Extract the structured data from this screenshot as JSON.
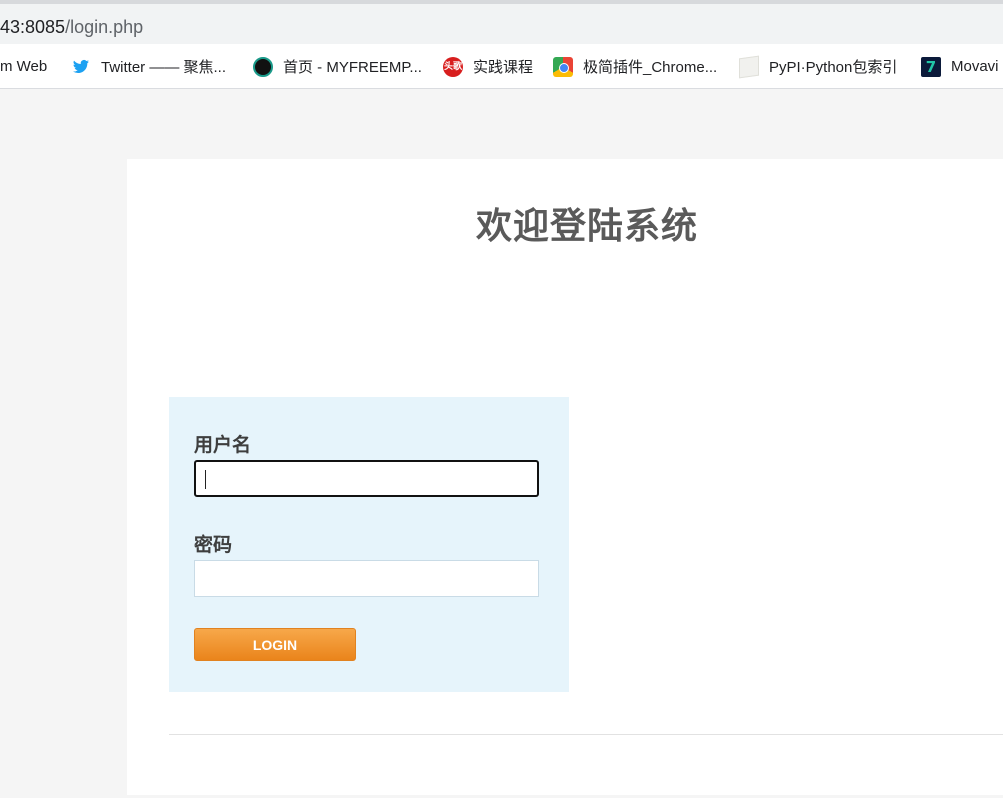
{
  "browser": {
    "url_host": "43:8085",
    "url_path": "/login.php"
  },
  "bookmarks": [
    {
      "label": "m Web",
      "icon": "none"
    },
    {
      "label": "Twitter —— 聚焦...",
      "icon": "twitter-icon"
    },
    {
      "label": "首页 - MYFREEMP...",
      "icon": "myfreemp-icon"
    },
    {
      "label": "实践课程",
      "icon": "toutiao-icon",
      "icon_text": "头歌"
    },
    {
      "label": "极简插件_Chrome...",
      "icon": "chrome-icon"
    },
    {
      "label": "PyPI·Python包索引",
      "icon": "pypi-icon"
    },
    {
      "label": "Movavi",
      "icon": "movavi-icon",
      "icon_text": "7"
    }
  ],
  "page": {
    "title": "欢迎登陆系统"
  },
  "form": {
    "username_label": "用户名",
    "username_value": "",
    "password_label": "密码",
    "password_value": "",
    "login_label": "LOGIN"
  },
  "colors": {
    "title": "#5a5a5a",
    "form_bg": "#e6f4fb",
    "login_button": "#f08a24",
    "twitter": "#1da1f2"
  }
}
